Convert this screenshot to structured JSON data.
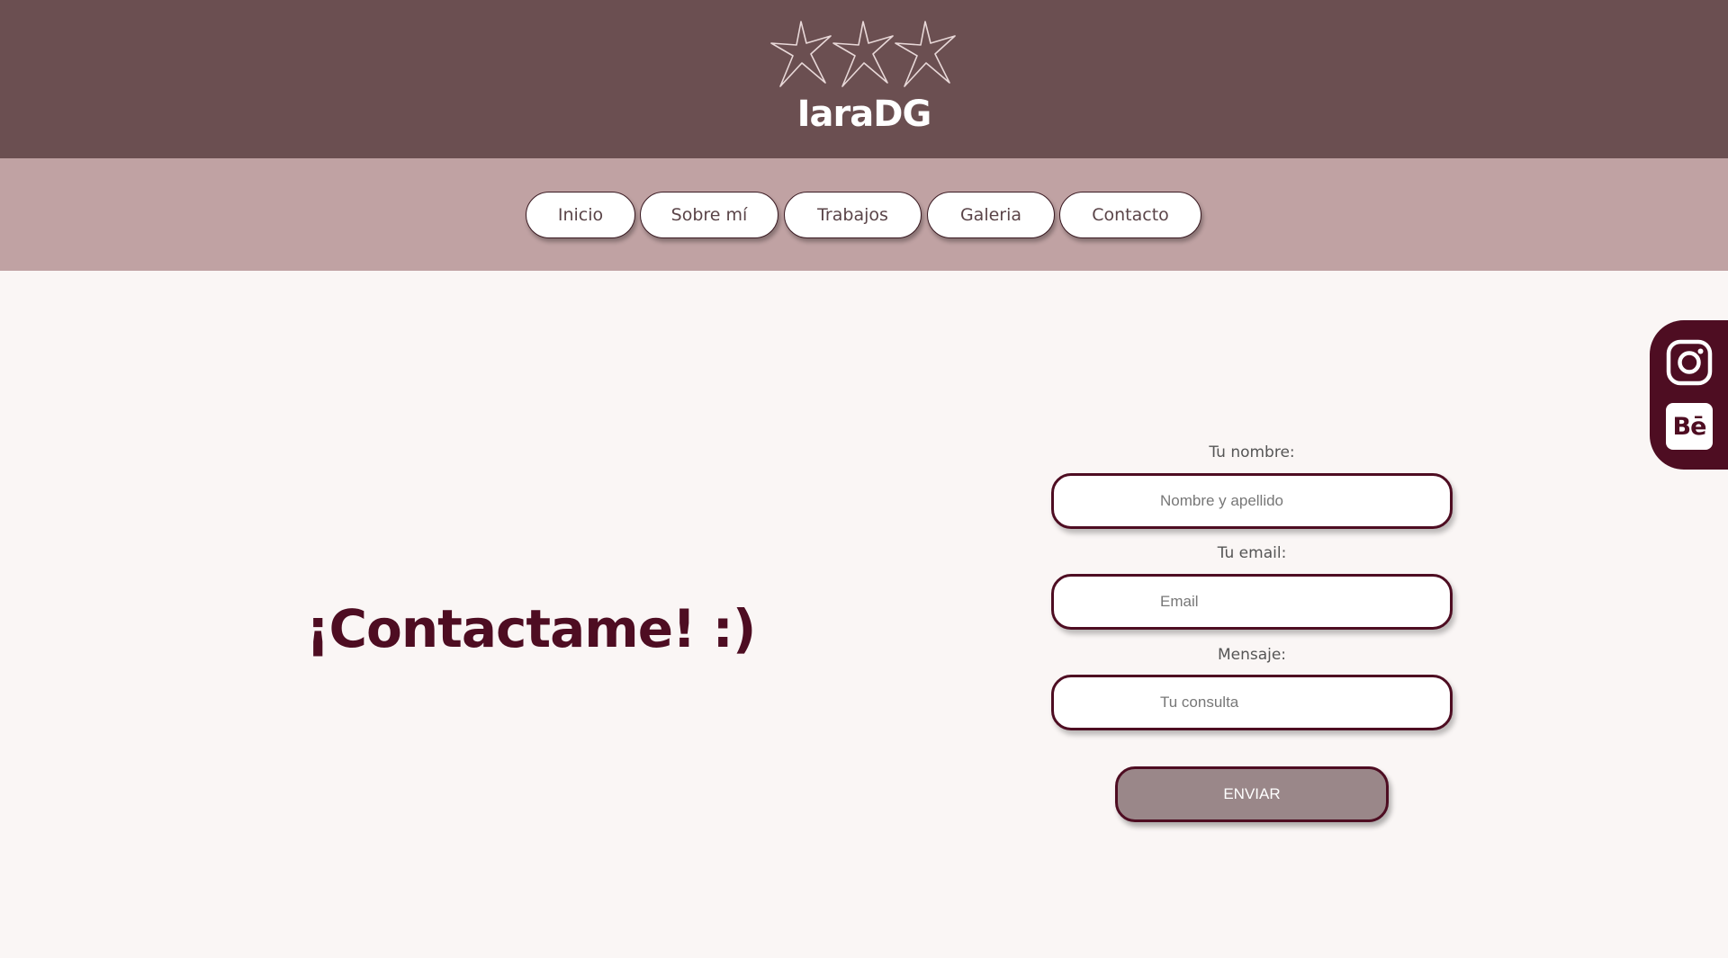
{
  "header": {
    "brand": "IaraDG",
    "logo_icon": "three-stars-icon"
  },
  "nav": {
    "items": [
      {
        "label": "Inicio"
      },
      {
        "label": "Sobre mí"
      },
      {
        "label": "Trabajos"
      },
      {
        "label": "Galeria"
      },
      {
        "label": "Contacto"
      }
    ]
  },
  "main": {
    "headline": "¡Contactame! :)"
  },
  "form": {
    "name_label": "Tu nombre:",
    "name_placeholder": "Nombre y apellido",
    "name_value": "",
    "email_label": "Tu email:",
    "email_placeholder": "Email",
    "email_value": "",
    "message_label": "Mensaje:",
    "message_placeholder": "Tu consulta",
    "message_value": "",
    "submit_label": "ENVIAR"
  },
  "social": {
    "items": [
      {
        "icon": "instagram-icon"
      },
      {
        "icon": "behance-icon",
        "glyph": "Bē"
      }
    ]
  },
  "colors": {
    "header_bg": "#6b4f51",
    "nav_bg": "#c0a2a3",
    "page_bg": "#faf6f5",
    "accent": "#4e0d22",
    "button_bg": "#9a8789"
  }
}
